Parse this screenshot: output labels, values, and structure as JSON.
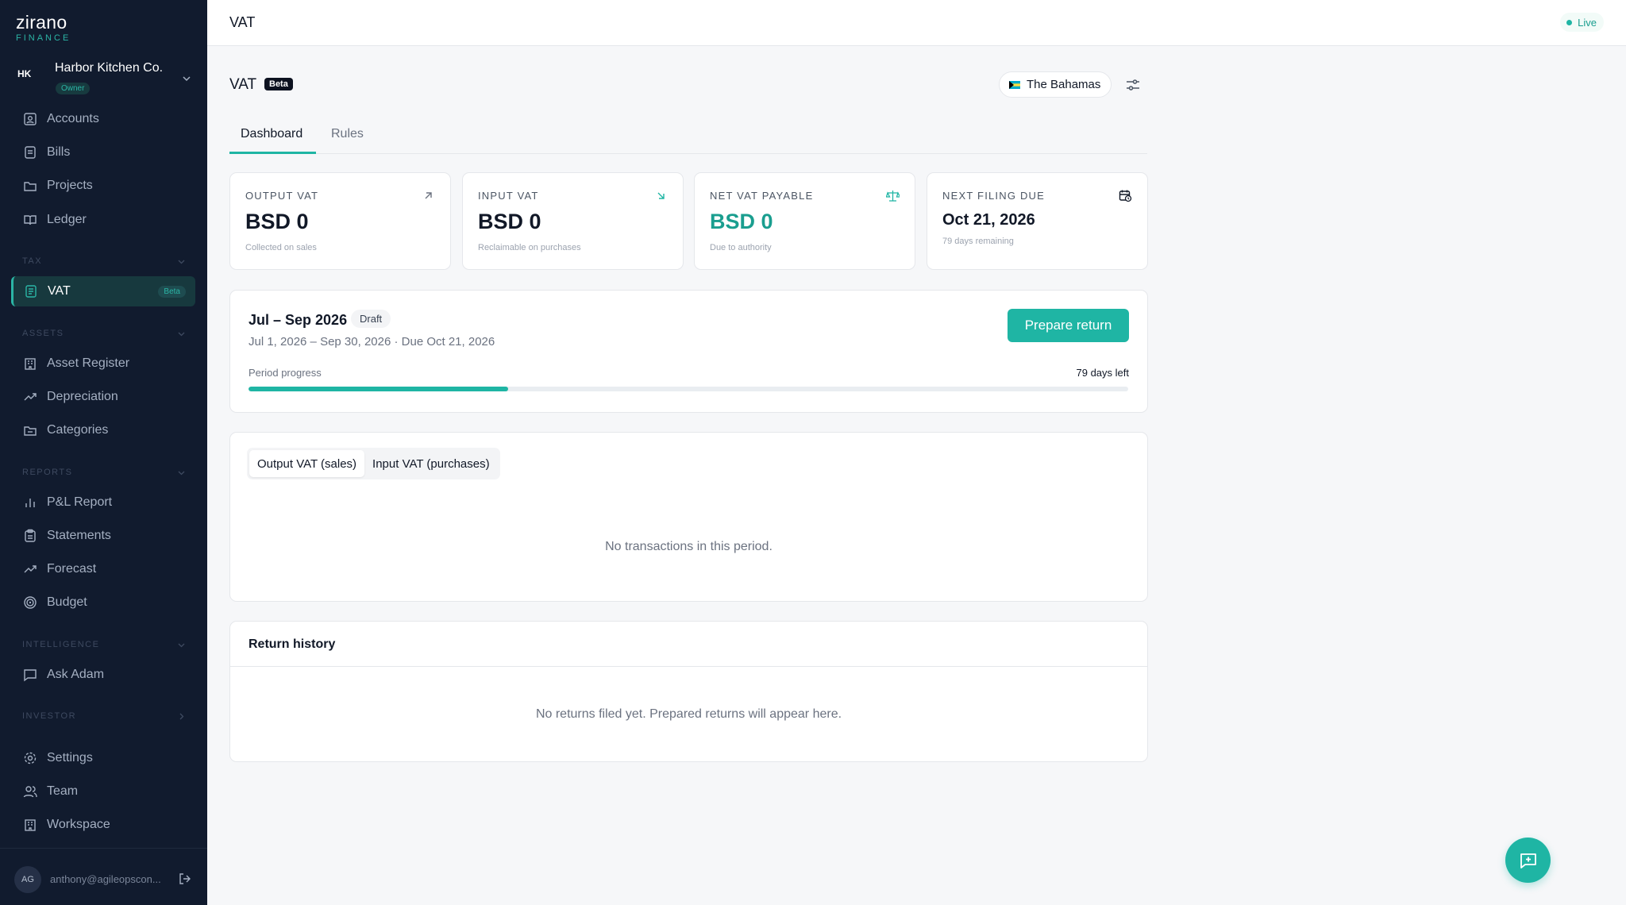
{
  "brand": {
    "name": "zirano",
    "subtitle": "FINANCE"
  },
  "org": {
    "initials": "HK",
    "name": "Harbor Kitchen Co.",
    "role": "Owner"
  },
  "nav": {
    "accounts": "Accounts",
    "bills": "Bills",
    "projects": "Projects",
    "ledger": "Ledger",
    "tax_section": "TAX",
    "vat": "VAT",
    "vat_badge": "Beta",
    "assets_section": "ASSETS",
    "asset_register": "Asset Register",
    "depreciation": "Depreciation",
    "categories": "Categories",
    "reports_section": "REPORTS",
    "pl_report": "P&L Report",
    "statements": "Statements",
    "forecast": "Forecast",
    "budget": "Budget",
    "intelligence_section": "INTELLIGENCE",
    "ask_adam": "Ask Adam",
    "investor_section": "INVESTOR",
    "settings": "Settings",
    "team": "Team",
    "workspace": "Workspace"
  },
  "user": {
    "initials": "AG",
    "email": "anthony@agileopscon..."
  },
  "topbar": {
    "title": "VAT",
    "status": "Live"
  },
  "page": {
    "title": "VAT",
    "badge": "Beta",
    "country": "The Bahamas"
  },
  "tabs": {
    "dashboard": "Dashboard",
    "rules": "Rules"
  },
  "stats": {
    "output": {
      "label": "OUTPUT VAT",
      "value": "BSD 0",
      "sub": "Collected on sales"
    },
    "input": {
      "label": "INPUT VAT",
      "value": "BSD 0",
      "sub": "Reclaimable on purchases"
    },
    "net": {
      "label": "NET VAT PAYABLE",
      "value": "BSD 0",
      "sub": "Due to authority"
    },
    "next": {
      "label": "NEXT FILING DUE",
      "value": "Oct 21, 2026",
      "sub": "79 days remaining"
    }
  },
  "period": {
    "title": "Jul – Sep 2026",
    "status": "Draft",
    "dates": "Jul 1, 2026 – Sep 30, 2026 · Due Oct 21, 2026",
    "action": "Prepare return",
    "progress_label": "Period progress",
    "days_left": "79 days left",
    "progress": 0.295
  },
  "transactions": {
    "output_tab": "Output VAT (sales)",
    "input_tab": "Input VAT (purchases)",
    "empty": "No transactions in this period."
  },
  "history": {
    "title": "Return history",
    "empty": "No returns filed yet. Prepared returns will appear here."
  },
  "colors": {
    "accent": "#1fb5a4",
    "sidebar": "#111b2e"
  }
}
